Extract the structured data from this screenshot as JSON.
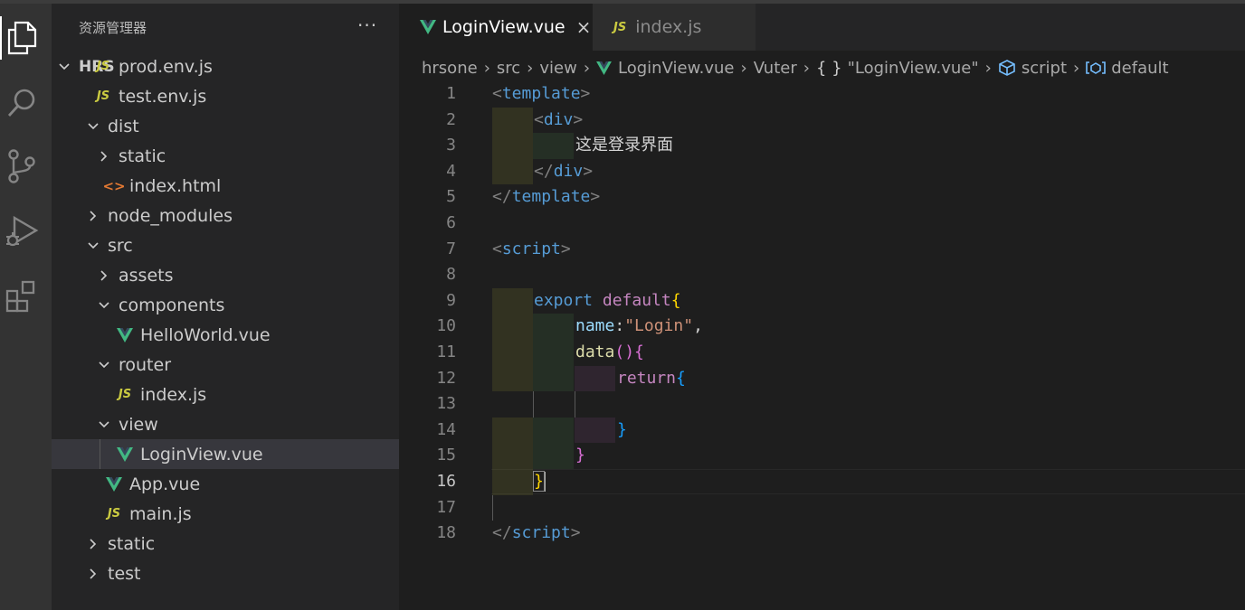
{
  "activity_bar": {
    "items": [
      "explorer-icon",
      "search-icon",
      "source-control-icon",
      "run-debug-icon",
      "extensions-icon"
    ]
  },
  "sidebar": {
    "title": "资源管理器",
    "more": "···",
    "root": "HRS",
    "tree": [
      {
        "label": "prod.env.js",
        "type": "js",
        "depth": 1
      },
      {
        "label": "test.env.js",
        "type": "js",
        "depth": 1
      },
      {
        "label": "dist",
        "type": "folder-open",
        "depth": 1
      },
      {
        "label": "static",
        "type": "folder",
        "depth": 2
      },
      {
        "label": "index.html",
        "type": "html",
        "depth": 2
      },
      {
        "label": "node_modules",
        "type": "folder",
        "depth": 1
      },
      {
        "label": "src",
        "type": "folder-open",
        "depth": 1
      },
      {
        "label": "assets",
        "type": "folder",
        "depth": 2
      },
      {
        "label": "components",
        "type": "folder-open",
        "depth": 2
      },
      {
        "label": "HelloWorld.vue",
        "type": "vue",
        "depth": 3
      },
      {
        "label": "router",
        "type": "folder-open",
        "depth": 2
      },
      {
        "label": "index.js",
        "type": "js",
        "depth": 3
      },
      {
        "label": "view",
        "type": "folder-open",
        "depth": 2
      },
      {
        "label": "LoginView.vue",
        "type": "vue",
        "depth": 3,
        "selected": true
      },
      {
        "label": "App.vue",
        "type": "vue",
        "depth": 2
      },
      {
        "label": "main.js",
        "type": "js",
        "depth": 2
      },
      {
        "label": "static",
        "type": "folder",
        "depth": 1
      },
      {
        "label": "test",
        "type": "folder",
        "depth": 1
      }
    ]
  },
  "tabs": [
    {
      "label": "LoginView.vue",
      "icon": "vue-icon",
      "active": true,
      "close": "×"
    },
    {
      "label": "index.js",
      "icon": "js-icon",
      "active": false,
      "js_badge": "JS"
    }
  ],
  "breadcrumb": {
    "items": [
      "hrsone",
      "src",
      "view",
      "LoginView.vue",
      "Vuter",
      "\"LoginView.vue\"",
      "script",
      "default"
    ],
    "obj_glyph": "{ }"
  },
  "editor": {
    "current_line": 16,
    "line_numbers": [
      "1",
      "2",
      "3",
      "4",
      "5",
      "6",
      "7",
      "8",
      "9",
      "10",
      "11",
      "12",
      "13",
      "14",
      "15",
      "16",
      "17",
      "18"
    ],
    "text": {
      "l1_tag": "template",
      "l2_tag": "div",
      "l3_text": "这是登录界面",
      "l4_tag": "div",
      "l5_tag": "template",
      "l7_tag": "script",
      "l9_export": "export",
      "l9_default": "default",
      "l9_brace": "{",
      "l10_key": "name",
      "l10_colon": ":",
      "l10_value": "\"Login\"",
      "l10_comma": ",",
      "l11_fn": "data",
      "l11_parens": "()",
      "l11_brace": "{",
      "l12_return": "return",
      "l12_brace": "{",
      "l14_brace": "}",
      "l15_brace": "}",
      "l16_brace": "}",
      "l18_tag": "script"
    }
  },
  "colors": {
    "activity_bar": "#333333",
    "sidebar": "#252526",
    "editor": "#1e1e1e",
    "selected_row": "#37373d",
    "vue_green": "#42b883",
    "js_yellow": "#cbcb41"
  }
}
